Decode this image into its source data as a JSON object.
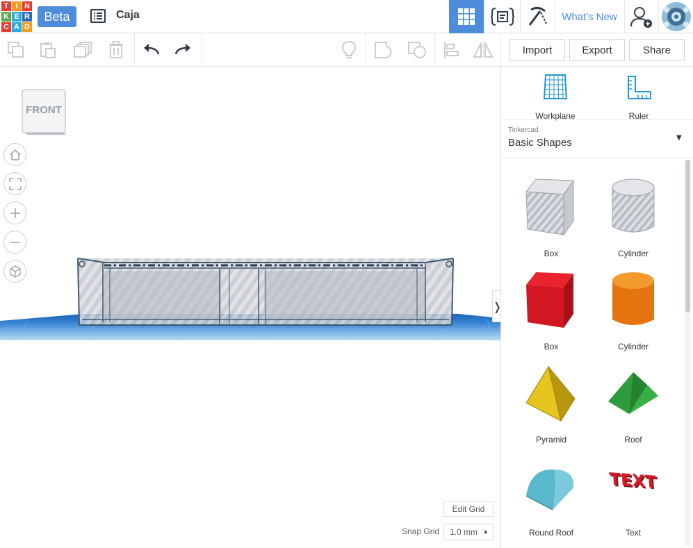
{
  "app": {
    "logo_letters": [
      "T",
      "I",
      "N",
      "K",
      "E",
      "R",
      "C",
      "A",
      "D"
    ],
    "logo_colors": [
      "#e8382f",
      "#f39c1f",
      "#e8382f",
      "#5aa74b",
      "#2ca9df",
      "#2f6bb4",
      "#e8382f",
      "#2ca9df",
      "#f39c1f"
    ],
    "beta_label": "Beta",
    "design_title": "Caja",
    "whats_new_label": "What's New",
    "accent": "#4d8ddc"
  },
  "toolbar": {
    "import_label": "Import",
    "export_label": "Export",
    "share_label": "Share"
  },
  "viewcube": {
    "face_label": "FRONT"
  },
  "canvas": {
    "edit_grid_label": "Edit Grid",
    "snap_grid_label": "Snap Grid",
    "snap_grid_value": "1.0 mm",
    "collapse_glyph": "❭"
  },
  "sidebar": {
    "workplane_label": "Workplane",
    "ruler_label": "Ruler",
    "library_source": "Tinkercad",
    "library_name": "Basic Shapes",
    "shapes": [
      {
        "label": "Box",
        "icon": "box-hole-icon"
      },
      {
        "label": "Cylinder",
        "icon": "cylinder-hole-icon"
      },
      {
        "label": "Box",
        "icon": "box-icon"
      },
      {
        "label": "Cylinder",
        "icon": "cylinder-icon"
      },
      {
        "label": "Pyramid",
        "icon": "pyramid-icon"
      },
      {
        "label": "Roof",
        "icon": "roof-icon"
      },
      {
        "label": "Round Roof",
        "icon": "round-roof-icon"
      },
      {
        "label": "Text",
        "icon": "text-shape-icon",
        "shape_text": "TEXT"
      }
    ]
  }
}
